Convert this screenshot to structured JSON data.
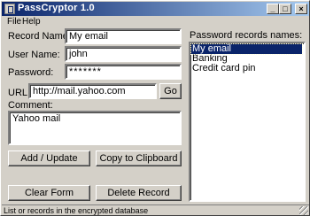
{
  "window": {
    "title": "PassCryptor 1.0"
  },
  "titlebar_buttons": {
    "minimize": "_",
    "maximize": "□",
    "close": "×"
  },
  "menu": [
    "File",
    "Help"
  ],
  "form": {
    "record_name_label": "Record Name:",
    "record_name_value": "My email",
    "user_name_label": "User Name:",
    "user_name_value": "john",
    "password_label": "Password:",
    "password_value": "*******",
    "url_label": "URL:",
    "url_value": "http://mail.yahoo.com",
    "go_label": "Go",
    "comment_label": "Comment:",
    "comment_value": "Yahoo mail"
  },
  "buttons": {
    "add_update": "Add / Update",
    "copy_clipboard": "Copy to Clipboard",
    "clear_form": "Clear Form",
    "delete_record": "Delete Record"
  },
  "records": {
    "label": "Password records names:",
    "items": [
      "My email",
      "Banking",
      "Credit card pin"
    ],
    "selected_index": 0
  },
  "status": {
    "text": "List or records in the encrypted database"
  }
}
